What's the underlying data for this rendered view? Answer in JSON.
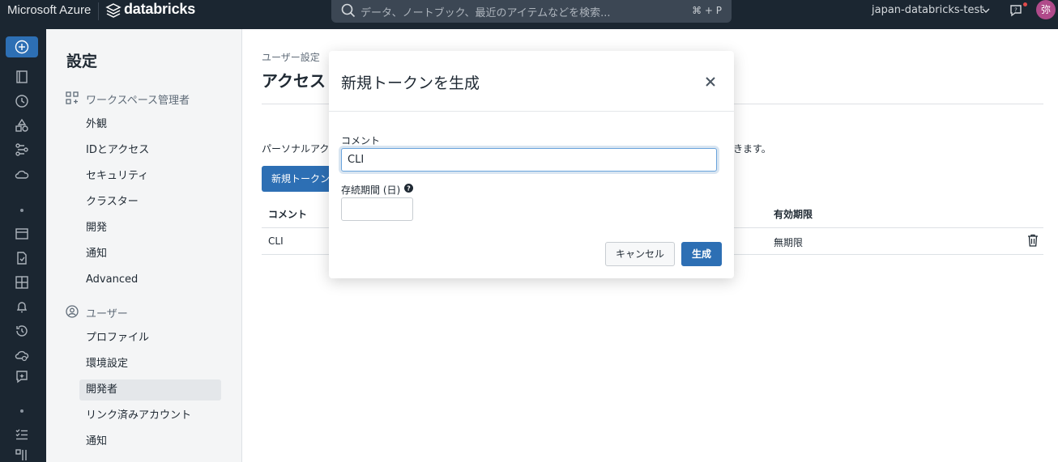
{
  "topbar": {
    "brand": "Microsoft Azure",
    "product": "databricks",
    "search_placeholder": "データ、ノートブック、最近のアイテムなどを検索...",
    "search_shortcut": "⌘ + P",
    "workspace": "japan-databricks-test",
    "avatar_initial": "弥"
  },
  "sidebar": {
    "title": "設定",
    "admin_section": "ワークスペース管理者",
    "admin_items": [
      "外観",
      "IDとアクセス",
      "セキュリティ",
      "クラスター",
      "開発",
      "通知",
      "Advanced"
    ],
    "user_section": "ユーザー",
    "user_items": [
      "プロファイル",
      "環境設定",
      "開発者",
      "リンク済みアカウント",
      "通知"
    ],
    "active_item": "開発者"
  },
  "main": {
    "breadcrumb": "ユーザー設定",
    "title": "アクセス",
    "description_start": "パーソナルアク",
    "description_end": "きます。",
    "new_token_button": "新規トークン",
    "table": {
      "headers": [
        "コメント",
        "有効期限"
      ],
      "rows": [
        {
          "comment": "CLI",
          "expires": "無期限"
        }
      ]
    }
  },
  "modal": {
    "title": "新規トークンを生成",
    "comment_label": "コメント",
    "comment_value": "CLI",
    "lifetime_label": "存続期間 (日)",
    "lifetime_value": "",
    "cancel_button": "キャンセル",
    "generate_button": "生成"
  }
}
